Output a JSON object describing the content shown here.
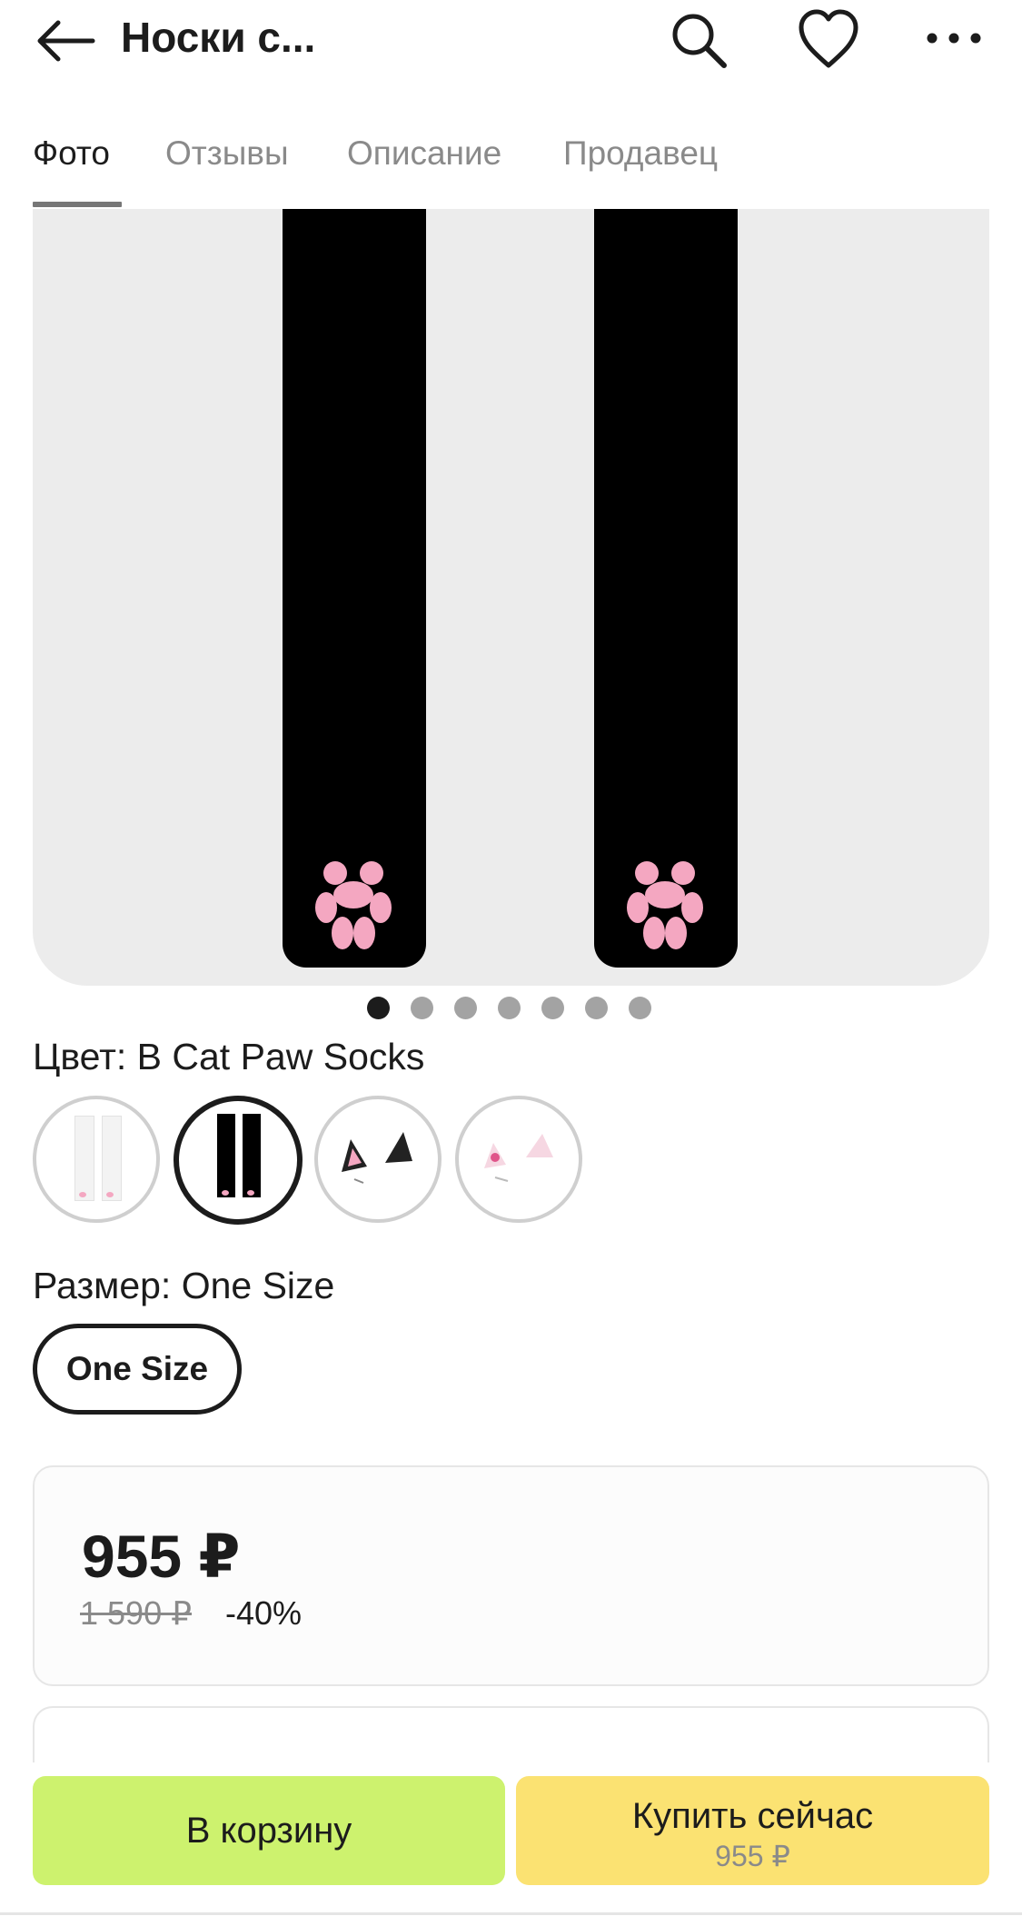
{
  "header": {
    "title": "Носки с...",
    "icons": {
      "back": "arrow-left-icon",
      "search": "search-icon",
      "favorite": "heart-icon",
      "more": "more-horizontal-icon"
    }
  },
  "tabs": [
    {
      "label": "Фото",
      "active": true
    },
    {
      "label": "Отзывы",
      "active": false
    },
    {
      "label": "Описание",
      "active": false
    },
    {
      "label": "Продавец",
      "active": false
    }
  ],
  "gallery": {
    "total_images": 7,
    "current_index": 1
  },
  "color": {
    "label": "Цвет: B Cat Paw Socks",
    "options_count": 4,
    "selected_index": 2
  },
  "size": {
    "label": "Размер: One Size",
    "options": [
      "One Size"
    ]
  },
  "price": {
    "current": "955 ₽",
    "old": "1 590 ₽",
    "discount": "-40%"
  },
  "actions": {
    "cart": "В корзину",
    "buy": "Купить сейчас",
    "buy_price": "955 ₽"
  },
  "colors": {
    "cart_button": "#cdf26e",
    "buy_button": "#fbe272",
    "paw_pink": "#f4a7c1"
  }
}
